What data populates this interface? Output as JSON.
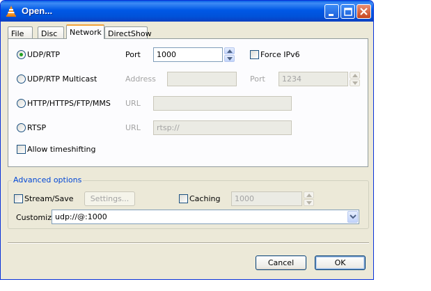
{
  "window": {
    "title": "Open...",
    "icon": "vlc-cone-icon"
  },
  "titlebar_buttons": [
    "minimize-icon",
    "maximize-icon",
    "close-icon"
  ],
  "tabs": [
    {
      "label": "File",
      "active": false
    },
    {
      "label": "Disc",
      "active": false
    },
    {
      "label": "Network",
      "active": true
    },
    {
      "label": "DirectShow",
      "active": false
    }
  ],
  "network": {
    "udp_rtp": {
      "label": "UDP/RTP",
      "selected": true,
      "port_label": "Port",
      "port_value": "1000"
    },
    "force_ipv6": {
      "label": "Force IPv6",
      "checked": false
    },
    "udp_multicast": {
      "label": "UDP/RTP Multicast",
      "address_label": "Address",
      "address_value": "",
      "port_label": "Port",
      "port_value": "1234"
    },
    "http": {
      "label": "HTTP/HTTPS/FTP/MMS",
      "url_label": "URL",
      "url_value": ""
    },
    "rtsp": {
      "label": "RTSP",
      "url_label": "URL",
      "url_value": "rtsp://"
    },
    "allow_timeshifting": {
      "label": "Allow timeshifting",
      "checked": false
    }
  },
  "advanced": {
    "title": "Advanced options",
    "stream_save": {
      "label": "Stream/Save",
      "checked": false
    },
    "settings_button": "Settings...",
    "caching": {
      "label": "Caching",
      "checked": false,
      "value": "1000"
    },
    "customize_label": "Customize:",
    "customize_value": "udp://@:1000"
  },
  "footer": {
    "cancel_label": "Cancel",
    "ok_label": "OK"
  },
  "colors": {
    "titlebar": "#0058e6",
    "window_bg": "#ece9d8",
    "radio_dot": "#21a121",
    "group_title": "#0046d5"
  }
}
